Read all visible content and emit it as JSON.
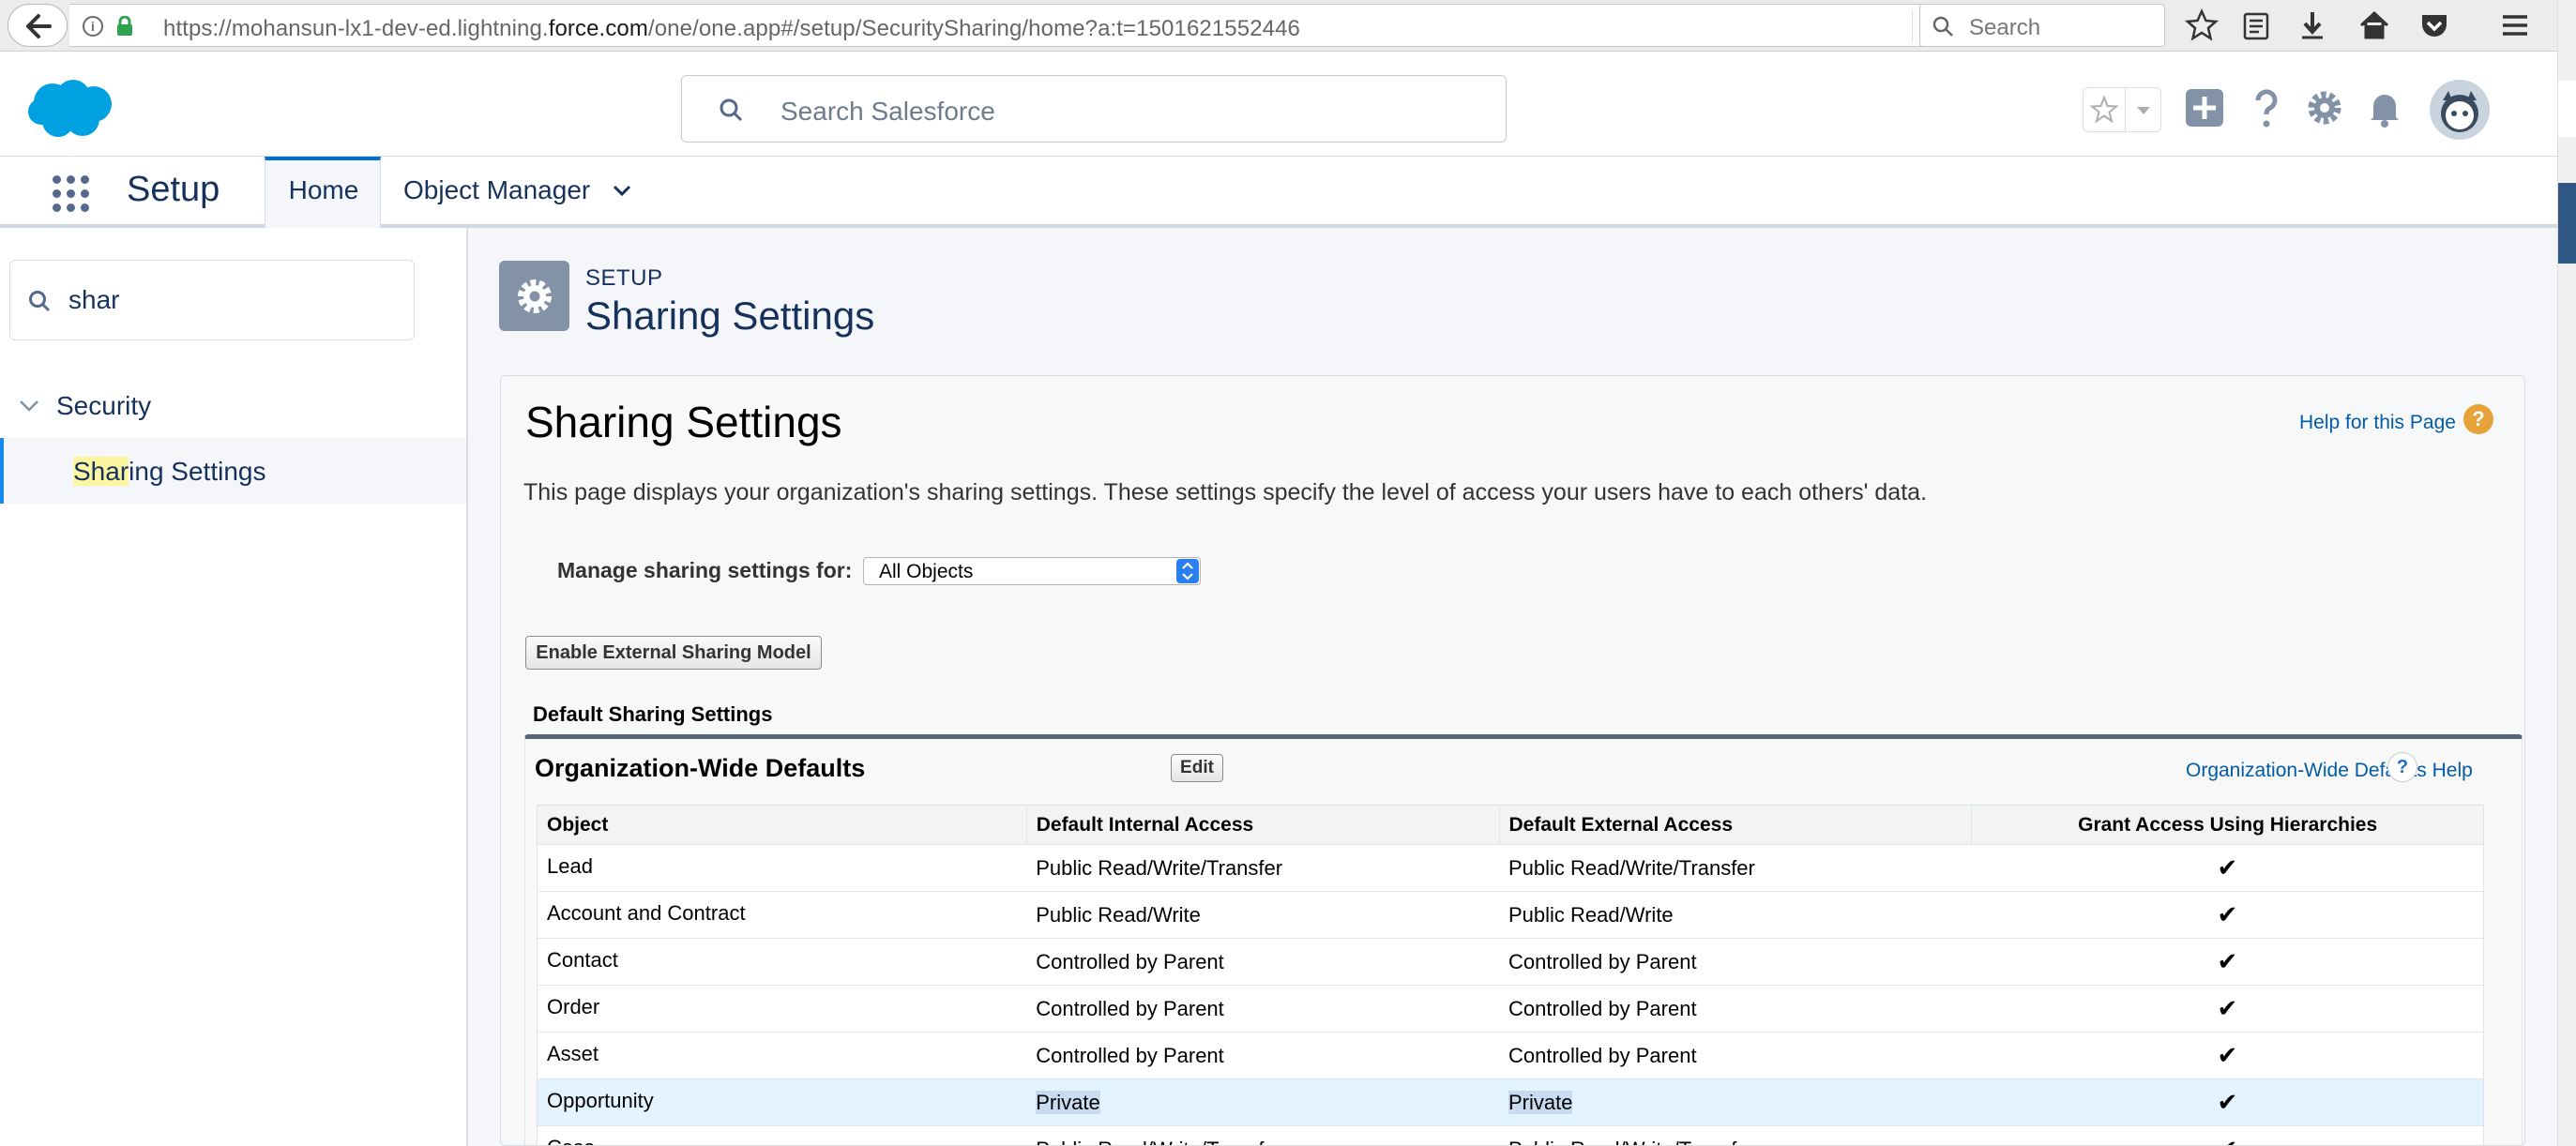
{
  "browser": {
    "url_prefix": "https://mohansun-lx1-dev-ed.lightning.",
    "url_domain": "force.com",
    "url_suffix": "/one/one.app#/setup/SecuritySharing/home?a:t=1501621552446",
    "search_placeholder": "Search"
  },
  "header": {
    "search_placeholder": "Search Salesforce"
  },
  "nav": {
    "app_name": "Setup",
    "tabs": [
      {
        "label": "Home",
        "active": true
      },
      {
        "label": "Object Manager",
        "active": false
      }
    ]
  },
  "sidebar": {
    "quickfind_value": "shar",
    "tree": {
      "group_label": "Security",
      "item_highlight": "Shar",
      "item_rest": "ing Settings"
    }
  },
  "page": {
    "eyebrow": "SETUP",
    "title": "Sharing Settings",
    "card_title": "Sharing Settings",
    "help_link": "Help for this Page",
    "description": "This page displays your organization's sharing settings. These settings specify the level of access your users have to each others' data.",
    "manage_label": "Manage sharing settings for:",
    "manage_value": "All Objects",
    "external_button": "Enable External Sharing Model",
    "section_label": "Default Sharing Settings"
  },
  "owd": {
    "title": "Organization-Wide Defaults",
    "edit_label": "Edit",
    "help_link": "Organization-Wide Defaults Help",
    "columns": [
      "Object",
      "Default Internal Access",
      "Default External Access",
      "Grant Access Using Hierarchies"
    ],
    "rows": [
      {
        "object": "Lead",
        "internal": "Public Read/Write/Transfer",
        "external": "Public Read/Write/Transfer",
        "grant": "✔"
      },
      {
        "object": "Account and Contract",
        "internal": "Public Read/Write",
        "external": "Public Read/Write",
        "grant": "✔"
      },
      {
        "object": "Contact",
        "internal": "Controlled by Parent",
        "external": "Controlled by Parent",
        "grant": "✔"
      },
      {
        "object": "Order",
        "internal": "Controlled by Parent",
        "external": "Controlled by Parent",
        "grant": "✔"
      },
      {
        "object": "Asset",
        "internal": "Controlled by Parent",
        "external": "Controlled by Parent",
        "grant": "✔"
      },
      {
        "object": "Opportunity",
        "internal": "Private",
        "external": "Private",
        "grant": "✔"
      },
      {
        "object": "Case",
        "internal": "Public Read/Write/Transfer",
        "external": "Public Read/Write/Transfer",
        "grant": "✔"
      }
    ]
  }
}
